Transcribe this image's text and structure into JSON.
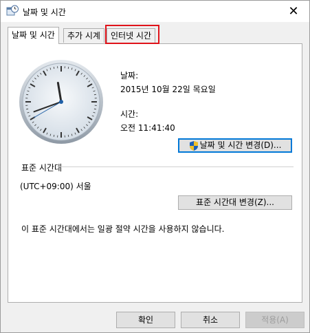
{
  "window": {
    "title": "날짜 및 시간",
    "close_icon": "close-icon",
    "app_icon": "date-time-icon"
  },
  "tabs": [
    {
      "label": "날짜 및 시간",
      "active": true
    },
    {
      "label": "추가 시계",
      "active": false
    },
    {
      "label": "인터넷 시간",
      "active": false,
      "highlighted": true
    }
  ],
  "datetime": {
    "date_label": "날짜:",
    "date_value": "2015년 10월 22일 목요일",
    "time_label": "시간:",
    "time_value": "오전 11:41:40",
    "change_button": "날짜 및 시간 변경(D)..."
  },
  "timezone": {
    "section_label": "표준 시간대",
    "value": "(UTC+09:00) 서울",
    "change_button": "표준 시간대 변경(Z)...",
    "dst_note": "이 표준 시간대에서는 일광 절약 시간을 사용하지 않습니다."
  },
  "footer": {
    "ok": "확인",
    "cancel": "취소",
    "apply": "적용(A)"
  },
  "colors": {
    "highlight": "#e0131a",
    "accent": "#0078d7"
  }
}
